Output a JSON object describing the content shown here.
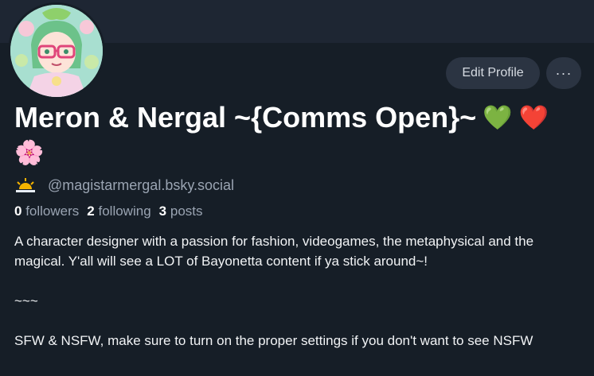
{
  "profile": {
    "display_name": "Meron & Nergal ~{Comms Open}~",
    "name_emojis": [
      "💚",
      "❤️"
    ],
    "name_emoji_2": "🌸",
    "handle_emoji_name": "sunrise-icon",
    "handle": "@magistarmergal.bsky.social",
    "stats": {
      "followers_count": "0",
      "followers_label": "followers",
      "following_count": "2",
      "following_label": "following",
      "posts_count": "3",
      "posts_label": "posts"
    },
    "bio": {
      "line1": "A character designer with a passion for fashion, videogames, the metaphysical and the magical. Y'all will see a LOT of Bayonetta content if ya stick around~!",
      "line2": "~~~",
      "line3": "SFW & NSFW, make sure to turn on the proper settings if you don't want to see NSFW"
    }
  },
  "actions": {
    "edit_label": "Edit Profile",
    "more_label": "···"
  },
  "colors": {
    "background": "#161e27",
    "banner": "#1e2633",
    "button_bg": "#2b3442",
    "muted_text": "#9aa4b2"
  }
}
